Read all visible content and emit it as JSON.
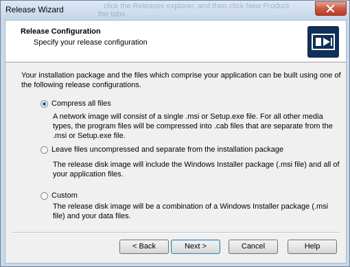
{
  "window": {
    "title": "Release Wizard",
    "background_hint": [
      "click the Releases explorer, and then click New Product",
      "the tabs"
    ]
  },
  "header": {
    "title": "Release Configuration",
    "subtitle": "Specify your release configuration"
  },
  "intro": "Your installation package and the files which comprise your application can be built using one of the following release configurations.",
  "options": [
    {
      "label": "Compress all files",
      "checked": true,
      "description": "A network image will consist of a single .msi or Setup.exe file. For all other media types, the program files will be compressed into .cab files that are separate from the .msi or Setup.exe file."
    },
    {
      "label": "Leave files uncompressed and separate from the installation package",
      "checked": false,
      "description": "The release disk image will include the Windows Installer package (.msi file) and all of your application files."
    },
    {
      "label": "Custom",
      "checked": false,
      "description": "The release disk image will be a combination of a Windows Installer package (.msi file) and your data files."
    }
  ],
  "buttons": {
    "back": "< Back",
    "next": "Next >",
    "cancel": "Cancel",
    "help": "Help"
  },
  "icons": {
    "close": "close-icon",
    "logo": "release-wizard-logo"
  },
  "colors": {
    "logo_bg": "#0f2f57",
    "radio_dot": "#1b5bb4",
    "close_button": "#c75a43"
  }
}
